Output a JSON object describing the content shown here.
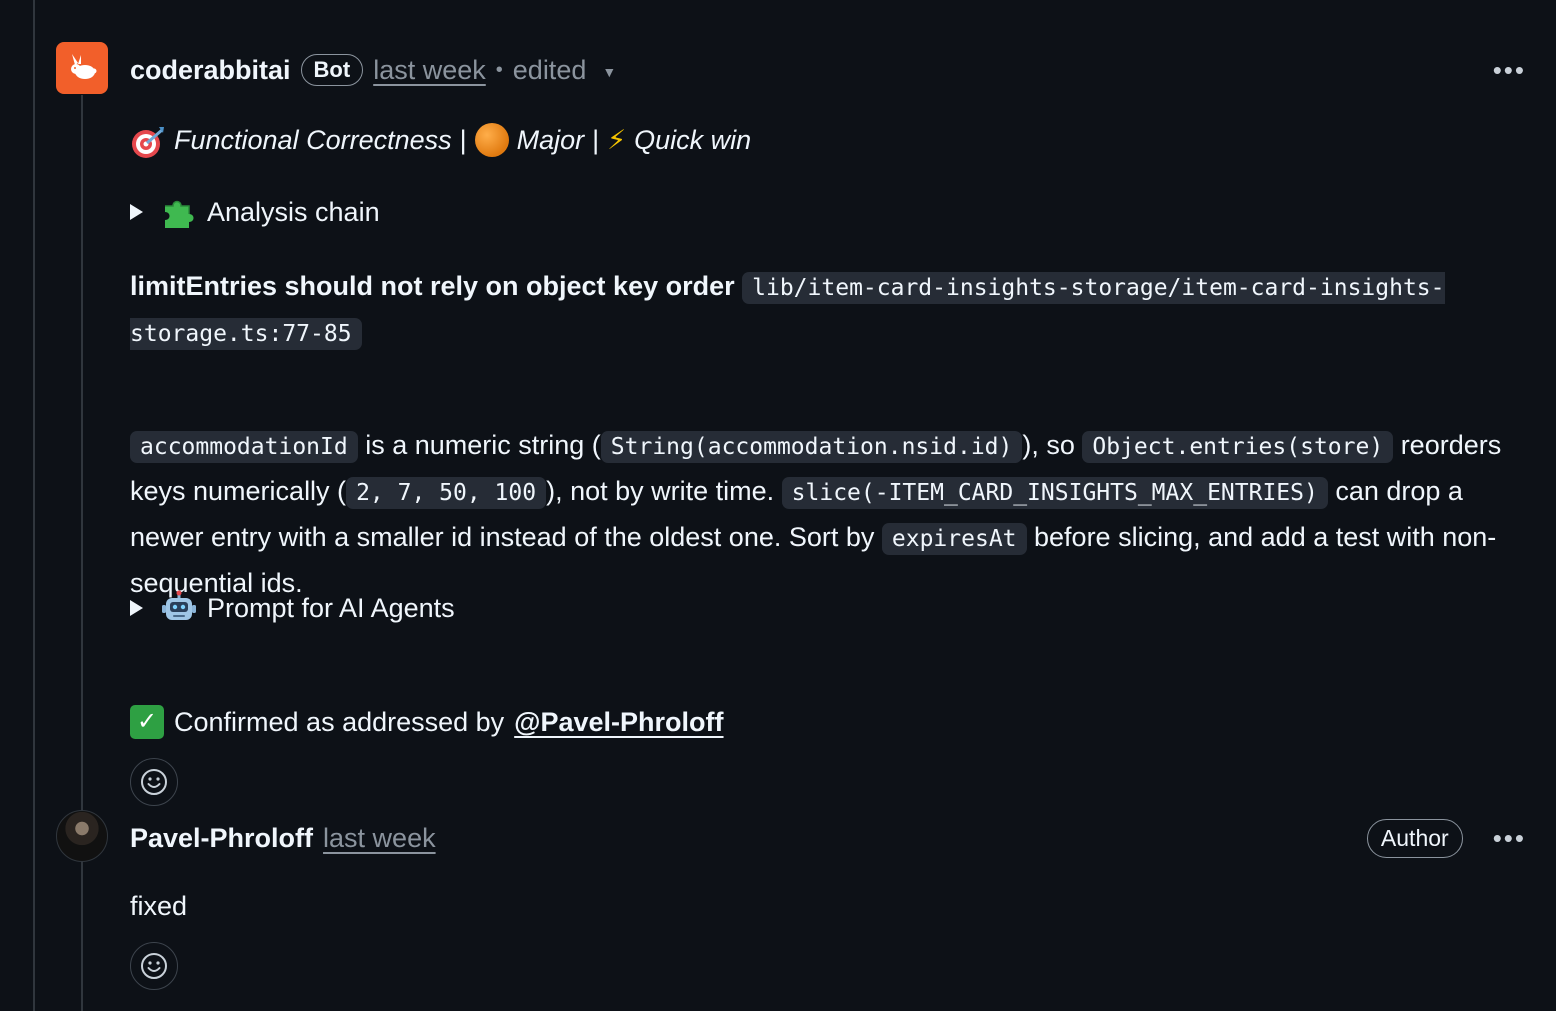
{
  "comment1": {
    "author": "coderabbitai",
    "badge": "Bot",
    "time": "last week",
    "separator": "•",
    "edited": "edited",
    "more": "•••",
    "tags": {
      "category": "Functional Correctness",
      "sep1": "|",
      "severity": "Major",
      "sep2": "|",
      "effort": "Quick win"
    },
    "analysis_chain": "Analysis chain",
    "heading": "limitEntries should not rely on object key order",
    "heading_path": "lib/item-card-insights-storage/item-card-insights-storage.ts:77-85",
    "para": {
      "c1": "accommodationId",
      "t1": " is a numeric string (",
      "c2": "String(accommodation.nsid.id)",
      "t2": "), so ",
      "c3": "Object.entries(store)",
      "t3": " reorders keys numerically (",
      "c4": "2, 7, 50, 100",
      "t4": "), not by write time. ",
      "c5": "slice(-ITEM_CARD_INSIGHTS_MAX_ENTRIES)",
      "t5": " can drop a newer entry with a smaller id instead of the oldest one. Sort by ",
      "c6": "expiresAt",
      "t6": " before slicing, and add a test with non-sequential ids."
    },
    "prompt_agents": "Prompt for AI Agents",
    "confirmed_text": "Confirmed as addressed by",
    "confirmed_mention": "@Pavel-Phroloff"
  },
  "comment2": {
    "author": "Pavel-Phroloff",
    "time": "last week",
    "badge": "Author",
    "more": "•••",
    "body": "fixed"
  },
  "icons": {
    "bot_avatar": "rabbit-icon",
    "target": "target-icon",
    "severity": "orange-circle-icon",
    "effort": "lightning-icon",
    "puzzle": "puzzle-icon",
    "robot": "robot-icon",
    "check": "check-mark-icon",
    "reaction": "smiley-icon"
  },
  "colors": {
    "background": "#0d1117",
    "text": "#f0f6fc",
    "muted": "#8b949e",
    "bot_avatar": "#f25f2a",
    "code_bg": "#262c36",
    "check_green": "#2ea043"
  }
}
